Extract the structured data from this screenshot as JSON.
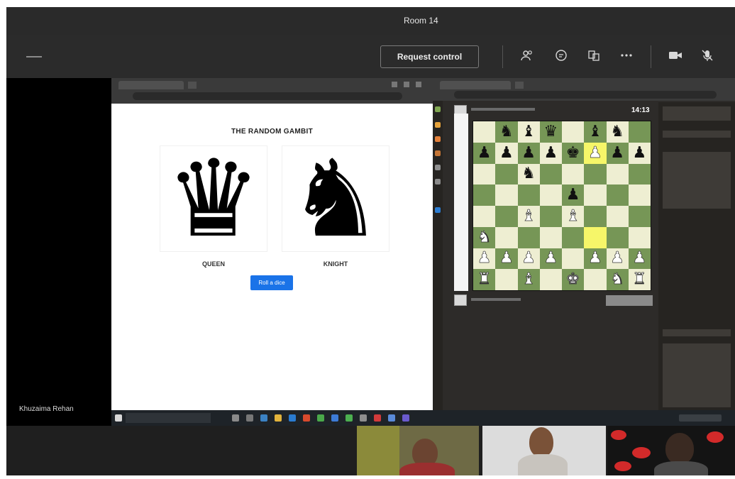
{
  "meeting": {
    "room_title": "Room 14",
    "request_control_label": "Request control",
    "presenter_name": "Khuzaima Rehan",
    "toolbar_icons": [
      "participants-icon",
      "chat-icon",
      "rooms-icon",
      "more-icon",
      "camera-icon",
      "mic-off-icon"
    ]
  },
  "random_gambit": {
    "heading": "THE RANDOM GAMBIT",
    "pieces": [
      {
        "name": "QUEEN",
        "glyph": "♛"
      },
      {
        "name": "KNIGHT",
        "glyph": "♞"
      }
    ],
    "roll_button_label": "Roll a dice"
  },
  "chess": {
    "clock_top": "14:13",
    "board_colors": {
      "light": "#eeeed2",
      "dark": "#769656",
      "highlight": "#f6f669"
    },
    "position_rows": [
      [
        "",
        "bN",
        "bB",
        "bQ",
        "",
        "bB",
        "bN",
        ""
      ],
      [
        "bP",
        "bP",
        "bP",
        "bP",
        "bK",
        "wP",
        "bP",
        "bP"
      ],
      [
        "",
        "",
        "bN",
        "",
        "",
        "",
        "",
        ""
      ],
      [
        "",
        "",
        "",
        "",
        "bP",
        "",
        "",
        ""
      ],
      [
        "",
        "",
        "wB",
        "",
        "wB",
        "",
        "",
        ""
      ],
      [
        "wN",
        "",
        "",
        "",
        "",
        "",
        "",
        ""
      ],
      [
        "wP",
        "wP",
        "wP",
        "wP",
        "",
        "wP",
        "wP",
        "wP"
      ],
      [
        "wR",
        "",
        "wB",
        "",
        "wK",
        "",
        "wN",
        "wR"
      ]
    ],
    "highlighted_squares": [
      [
        1,
        5
      ],
      [
        5,
        5
      ]
    ]
  }
}
